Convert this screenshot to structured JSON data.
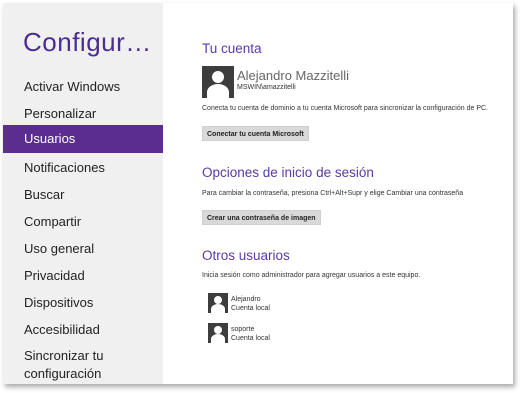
{
  "sidebar": {
    "title": "Configur…",
    "items": [
      {
        "label": "Activar Windows"
      },
      {
        "label": "Personalizar"
      },
      {
        "label": "Usuarios"
      },
      {
        "label": "Notificaciones"
      },
      {
        "label": "Buscar"
      },
      {
        "label": "Compartir"
      },
      {
        "label": "Uso general"
      },
      {
        "label": "Privacidad"
      },
      {
        "label": "Dispositivos"
      },
      {
        "label": "Accesibilidad"
      },
      {
        "label": "Sincronizar tu configuración"
      }
    ],
    "selected": "Usuarios",
    "accent_color": "#5c2d91"
  },
  "account": {
    "section_title": "Tu cuenta",
    "user_name": "Alejandro Mazzitelli",
    "user_account": "MSWIN\\amazzitelli",
    "description": "Conecta tu cuenta de dominio a tu cuenta Microsoft para sincronizar la configuración de PC.",
    "connect_button": "Conectar tu cuenta Microsoft",
    "avatar_icon": "user-silhouette-icon"
  },
  "signin": {
    "section_title": "Opciones de inicio de sesión",
    "description": "Para cambiar la contraseña, presiona Ctrl+Alt+Supr y elige Cambiar una contraseña",
    "picture_password_button": "Crear una contraseña de imagen"
  },
  "others": {
    "section_title": "Otros usuarios",
    "description": "Inicia sesión como administrador para agregar usuarios a este equipo.",
    "users": [
      {
        "name": "Alejandro",
        "type": "Cuenta local"
      },
      {
        "name": "soporte",
        "type": "Cuenta local"
      }
    ]
  }
}
